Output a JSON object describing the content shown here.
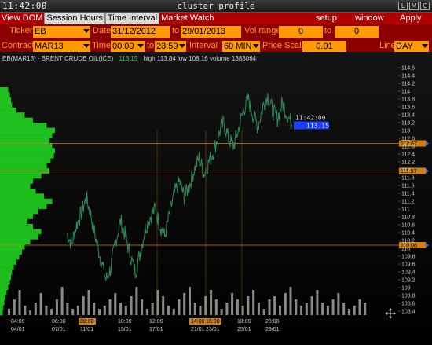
{
  "window": {
    "clock": "11:42:00",
    "title": "cluster profile",
    "buttons": [
      "L",
      "M",
      "C"
    ]
  },
  "menu": {
    "tabs": [
      "View DOM",
      "Session Hours",
      "Time Interval",
      "Market Watch"
    ],
    "selected": "Session Hours",
    "right_items": [
      "setup",
      "window",
      "Apply"
    ]
  },
  "controls": {
    "ticker_label": "Ticker",
    "ticker_value": "EB",
    "date_label": "Date",
    "date_from": "31/12/2012",
    "to_label": "to",
    "date_to": "29/01/2013",
    "vol_range_label": "Vol range",
    "vol_from": "0",
    "vol_to_label": "to",
    "vol_to": "0",
    "contract_label": "Contract",
    "contract_value": "MAR13",
    "time_label": "Time",
    "time_from": "00:00",
    "time_to_label": "to",
    "time_to": "23:59",
    "interval_label": "Interval",
    "interval_value": "60 MIN",
    "price_scale_label": "Price Scale",
    "price_scale_value": "0.01",
    "line_label": "Line",
    "line_value": "DAY"
  },
  "info": {
    "instrument": "EB(MAR13) - BRENT CRUDE OIL(ICE)",
    "last": "113.15",
    "high": "high 113.84",
    "low": "low 108.16",
    "volume": "volume 1388064"
  },
  "colors": {
    "menu_bg": "#b00000",
    "control_bg": "#8c0000",
    "field_bg": "#ff9900",
    "label": "#ff9a1a",
    "price_line": "#2e8b57",
    "profile": "#22dd22",
    "level_line": "#d08010",
    "last_price_box": "#1a3cff"
  },
  "chart_data": {
    "type": "line",
    "title": "EB(MAR13) - BRENT CRUDE OIL(ICE)",
    "ylim": [
      108.3,
      114.7
    ],
    "y_ticks": [
      "114.6",
      "114.4",
      "114.2",
      "114",
      "113.8",
      "113.6",
      "113.4",
      "113.2",
      "113",
      "112.8",
      "112.6",
      "112.4",
      "112.2",
      "112",
      "111.8",
      "111.6",
      "111.4",
      "111.2",
      "111",
      "110.8",
      "110.6",
      "110.4",
      "110.2",
      "110",
      "109.8",
      "109.6",
      "109.4",
      "109.2",
      "109",
      "108.8",
      "108.6",
      "108.4"
    ],
    "x_ticks_top": [
      "04:00",
      "06:00",
      "08:00",
      "10:00",
      "12:00",
      "14:00",
      "16:00",
      "18:00",
      "20:00"
    ],
    "x_ticks_bottom": [
      "04/01",
      "07/01",
      "11/01",
      "15/01",
      "17/01",
      "21/01",
      "23/01",
      "25/01",
      "29/01"
    ],
    "highlighted_x_ticks": [
      "08:00",
      "06:00",
      "10:00"
    ],
    "price_levels": [
      {
        "label": "112.67",
        "value": 112.67
      },
      {
        "label": "111.97",
        "value": 111.97
      },
      {
        "label": "110.08",
        "value": 110.08
      }
    ],
    "last_price": {
      "time": "11:42:00",
      "value": "113.15"
    },
    "price_series": [
      110.4,
      110.1,
      110.6,
      110.9,
      111.3,
      110.8,
      110.2,
      109.7,
      109.2,
      109.5,
      110.2,
      110.7,
      110.3,
      109.8,
      109.4,
      109.9,
      110.5,
      110.8,
      111.0,
      110.6,
      110.3,
      110.9,
      111.4,
      111.7,
      111.3,
      111.6,
      112.0,
      112.3,
      111.9,
      112.2,
      112.5,
      112.9,
      113.2,
      112.8,
      112.6,
      113.0,
      113.5,
      113.8,
      113.4,
      113.1,
      113.6,
      113.9,
      113.5,
      113.3,
      113.7,
      113.4,
      113.15
    ],
    "volume_profile": [
      0.15,
      0.18,
      0.2,
      0.22,
      0.3,
      0.45,
      0.6,
      0.85,
      1.0,
      0.95,
      0.9,
      0.95,
      1.0,
      0.98,
      0.92,
      0.85,
      0.9,
      0.75,
      0.6,
      0.55,
      0.65,
      0.8,
      0.95,
      0.85,
      0.7,
      0.6,
      0.5,
      0.6,
      0.75,
      0.7,
      0.55,
      0.45,
      0.4,
      0.35,
      0.3,
      0.25,
      0.22,
      0.2,
      0.18,
      0.15,
      0.12,
      0.1,
      0.08,
      0.06,
      0.05
    ],
    "volume_bars": [
      0.2,
      0.5,
      0.8,
      0.3,
      0.15,
      0.4,
      0.7,
      0.3,
      0.2,
      0.5,
      0.9,
      0.4,
      0.2,
      0.3,
      0.6,
      0.8,
      0.4,
      0.2,
      0.3,
      0.5,
      0.7,
      0.4,
      0.3,
      0.6,
      0.9,
      0.5,
      0.2,
      0.4,
      0.8,
      0.6,
      0.3,
      0.2,
      0.5,
      0.7,
      0.9,
      0.4,
      0.3,
      0.6,
      0.8,
      0.5,
      0.2,
      0.4,
      0.7,
      0.5,
      0.3,
      0.6,
      0.8,
      0.4,
      0.2,
      0.5,
      0.6,
      0.3,
      0.7,
      0.9,
      0.5,
      0.3,
      0.4,
      0.6,
      0.8,
      0.4,
      0.3,
      0.5,
      0.7,
      0.4,
      0.2,
      0.3,
      0.5,
      0.4
    ]
  }
}
